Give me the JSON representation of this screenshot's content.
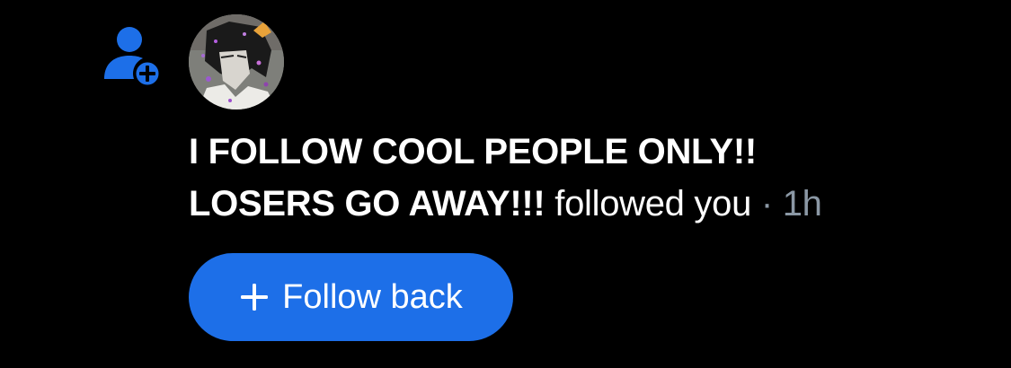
{
  "notification": {
    "icon": "follow-user-plus-icon",
    "icon_color": "#1d6fe8",
    "avatar": "user-avatar",
    "username_line1": "I FOLLOW COOL PEOPLE ONLY!!",
    "username_line2": "LOSERS GO AWAY!!!",
    "action": "followed you",
    "separator": "·",
    "time": "1h"
  },
  "follow_button": {
    "label": "Follow back",
    "icon": "plus-icon",
    "background": "#1d6fe8"
  }
}
